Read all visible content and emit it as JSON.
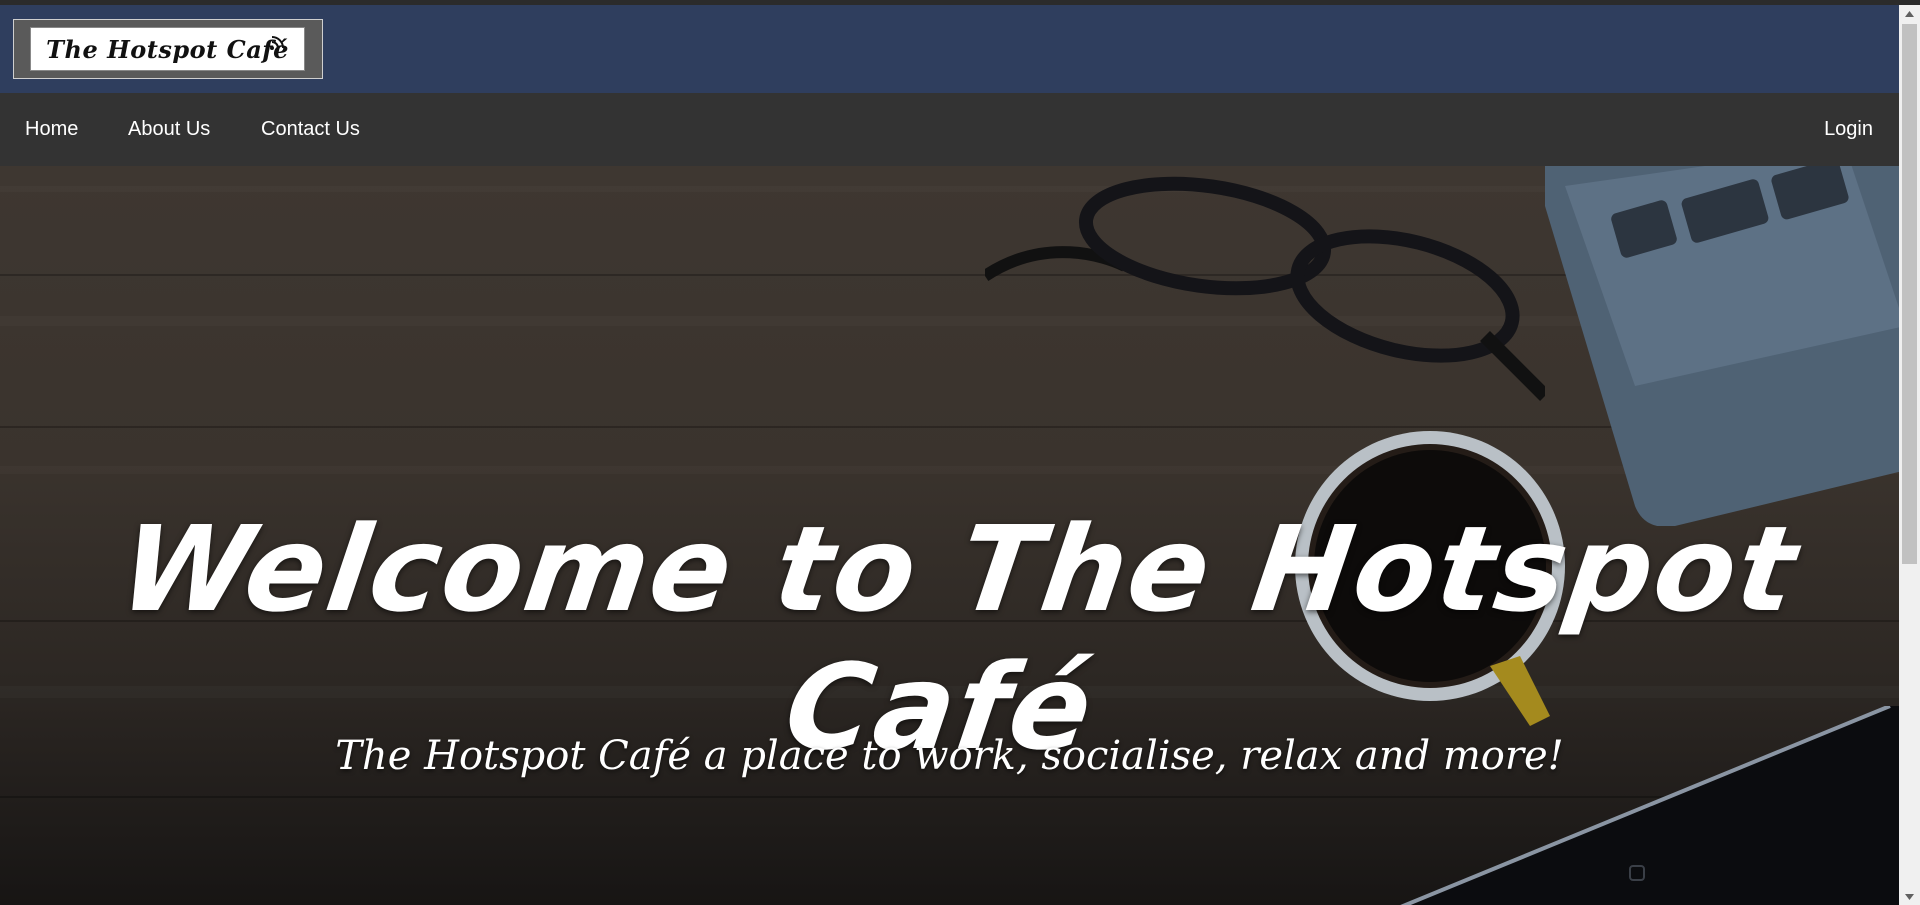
{
  "brand": {
    "logo_text": "The Hotspot Café"
  },
  "nav": {
    "links": [
      {
        "label": "Home"
      },
      {
        "label": "About Us"
      },
      {
        "label": "Contact Us"
      }
    ],
    "login_label": "Login"
  },
  "hero": {
    "title": "Welcome to The Hotspot Café",
    "subtitle": "The Hotspot Café a place to work, socialise, relax and more!"
  },
  "colors": {
    "brand_bar": "#2f3e5e",
    "nav_bar": "#333333",
    "text": "#ffffff"
  }
}
